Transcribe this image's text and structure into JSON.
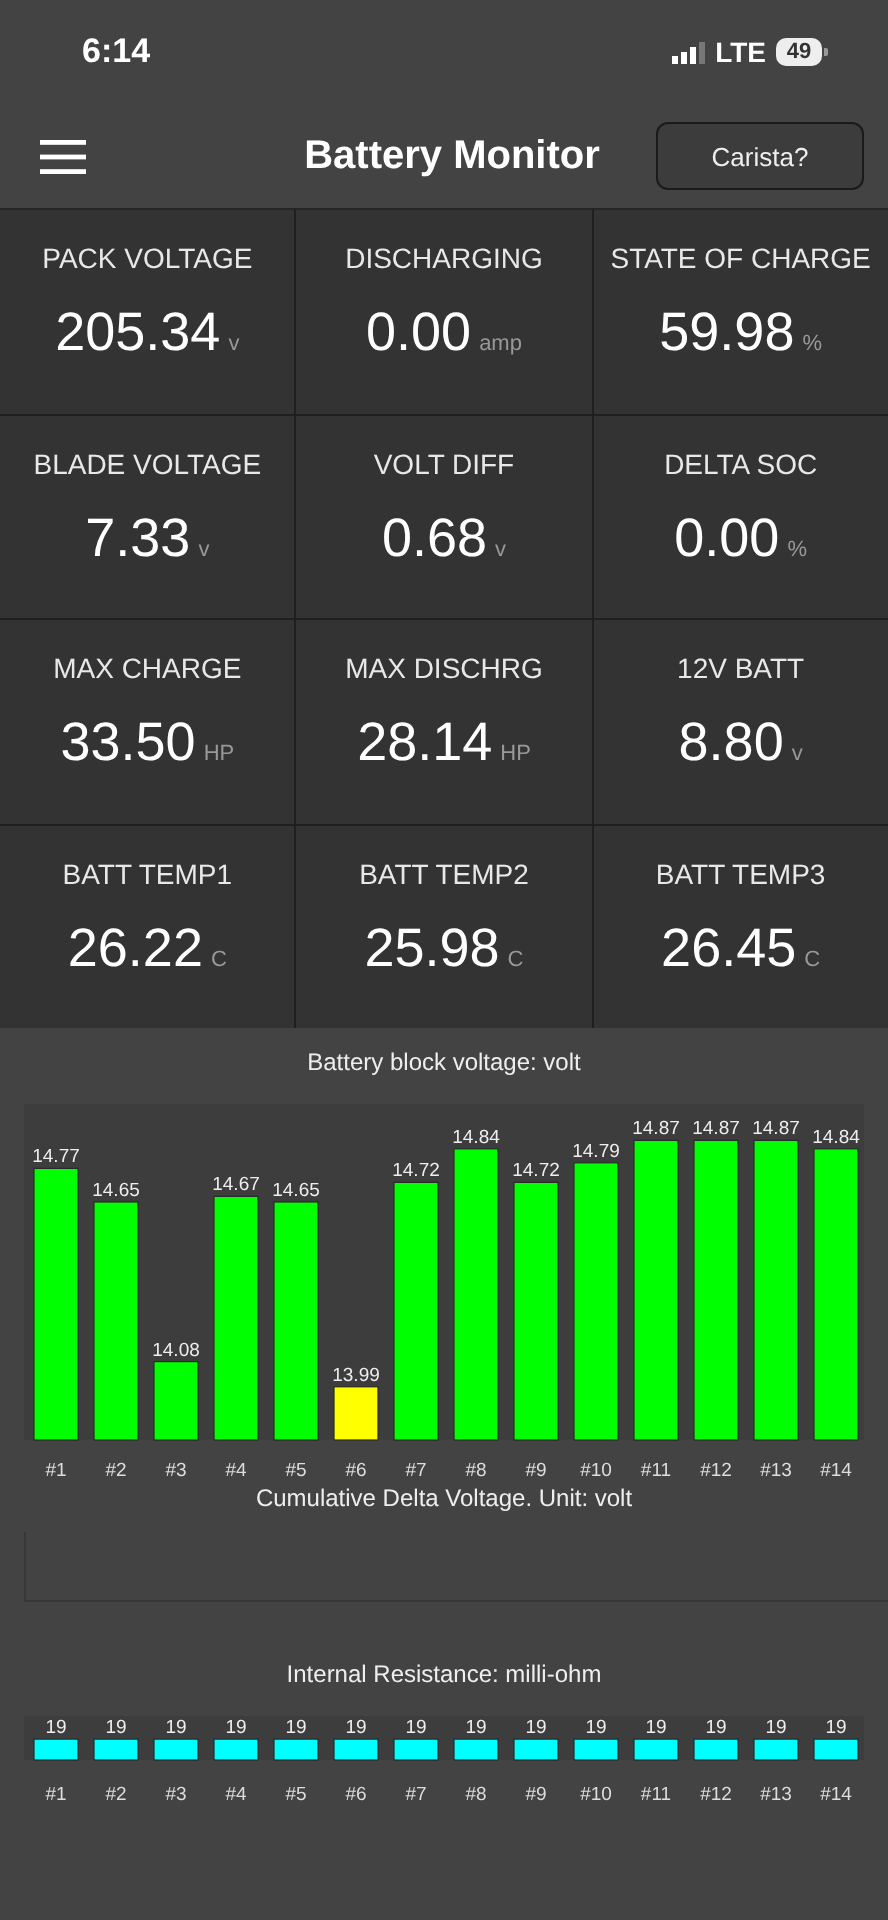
{
  "status_bar": {
    "time": "6:14",
    "network": "LTE",
    "battery": "49"
  },
  "header": {
    "title": "Battery Monitor",
    "button": "Carista?"
  },
  "metrics": [
    {
      "label": "PACK VOLTAGE",
      "value": "205.34",
      "unit": "v"
    },
    {
      "label": "DISCHARGING",
      "value": "0.00",
      "unit": "amp"
    },
    {
      "label": "STATE OF CHARGE",
      "value": "59.98",
      "unit": "%"
    },
    {
      "label": "BLADE VOLTAGE",
      "value": "7.33",
      "unit": "v"
    },
    {
      "label": "VOLT DIFF",
      "value": "0.68",
      "unit": "v"
    },
    {
      "label": "DELTA SOC",
      "value": "0.00",
      "unit": "%"
    },
    {
      "label": "MAX CHARGE",
      "value": "33.50",
      "unit": "HP"
    },
    {
      "label": "MAX DISCHRG",
      "value": "28.14",
      "unit": "HP"
    },
    {
      "label": "12V BATT",
      "value": "8.80",
      "unit": "v"
    },
    {
      "label": "BATT TEMP1",
      "value": "26.22",
      "unit": "C"
    },
    {
      "label": "BATT TEMP2",
      "value": "25.98",
      "unit": "C"
    },
    {
      "label": "BATT TEMP3",
      "value": "26.45",
      "unit": "C"
    }
  ],
  "charts": [
    {
      "kind": "bar",
      "chart_data": {
        "type": "bar",
        "title": "Battery block voltage: volt",
        "categories": [
          "#1",
          "#2",
          "#3",
          "#4",
          "#5",
          "#6",
          "#7",
          "#8",
          "#9",
          "#10",
          "#11",
          "#12",
          "#13",
          "#14"
        ],
        "data_labels": true,
        "ylim": [
          13.8,
          15.0
        ],
        "series": [
          {
            "color": "#00ff00",
            "values": [
              14.77,
              14.65,
              14.08,
              14.67,
              14.65,
              null,
              14.72,
              14.84,
              14.72,
              14.79,
              14.87,
              14.87,
              14.87,
              14.84
            ]
          },
          {
            "color": "#ffff00",
            "values": [
              null,
              null,
              null,
              null,
              null,
              13.99,
              null,
              null,
              null,
              null,
              null,
              null,
              null,
              null
            ]
          }
        ]
      }
    },
    {
      "kind": "empty",
      "title": "Cumulative Delta Voltage. Unit: volt"
    },
    {
      "kind": "bar",
      "chart_data": {
        "type": "bar",
        "title": "Internal Resistance: milli-ohm",
        "categories": [
          "#1",
          "#2",
          "#3",
          "#4",
          "#5",
          "#6",
          "#7",
          "#8",
          "#9",
          "#10",
          "#11",
          "#12",
          "#13",
          "#14"
        ],
        "data_labels": true,
        "ylim": [
          0,
          40
        ],
        "series": [
          {
            "color": "#00ffff",
            "values": [
              19,
              19,
              19,
              19,
              19,
              19,
              19,
              19,
              19,
              19,
              19,
              19,
              19,
              19
            ]
          }
        ]
      }
    }
  ]
}
